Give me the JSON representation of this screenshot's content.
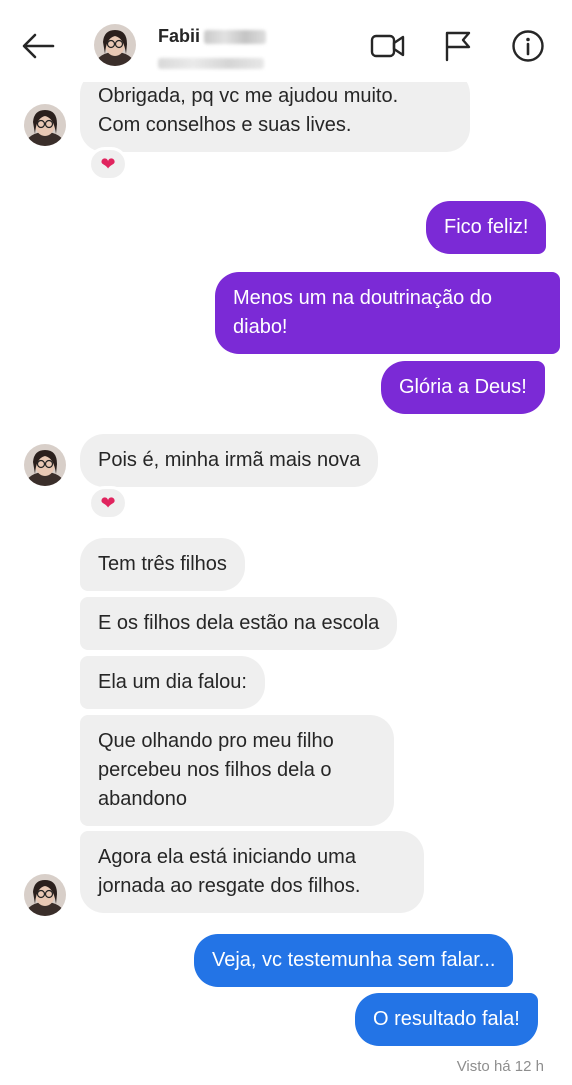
{
  "header": {
    "contact_name": "Fabii",
    "icons": [
      "back-arrow-icon",
      "video-camera-icon",
      "flag-icon",
      "info-icon"
    ]
  },
  "messages": [
    {
      "side": "in",
      "text": "Obrigada, pq vc me ajudou muito.\nCom conselhos e suas lives.",
      "reaction": "❤"
    },
    {
      "side": "out",
      "text": "Fico feliz!"
    },
    {
      "side": "out",
      "text": "Menos um na doutrinação do\ndiabo!"
    },
    {
      "side": "out",
      "text": "Glória a Deus!"
    },
    {
      "side": "in",
      "text": "Pois é, minha irmã mais nova",
      "reaction": "❤"
    },
    {
      "side": "in",
      "text": "Tem três filhos"
    },
    {
      "side": "in",
      "text": "E os filhos dela estão na escola"
    },
    {
      "side": "in",
      "text": "Ela um dia falou:"
    },
    {
      "side": "in",
      "text": "Que olhando pro meu filho\npercebeu nos filhos dela o\nabandono"
    },
    {
      "side": "in",
      "text": "Agora ela está iniciando uma\njornada ao resgate dos filhos."
    },
    {
      "side": "out",
      "text": "Veja, vc testemunha sem falar..."
    },
    {
      "side": "out",
      "text": "O resultado fala!"
    }
  ],
  "seen_status": "Visto há 12 h",
  "colors": {
    "incoming_bubble": "#efefef",
    "outgoing_purple": "#7b2ad6",
    "outgoing_blue": "#2374e6",
    "reaction_heart": "#e0245e"
  }
}
